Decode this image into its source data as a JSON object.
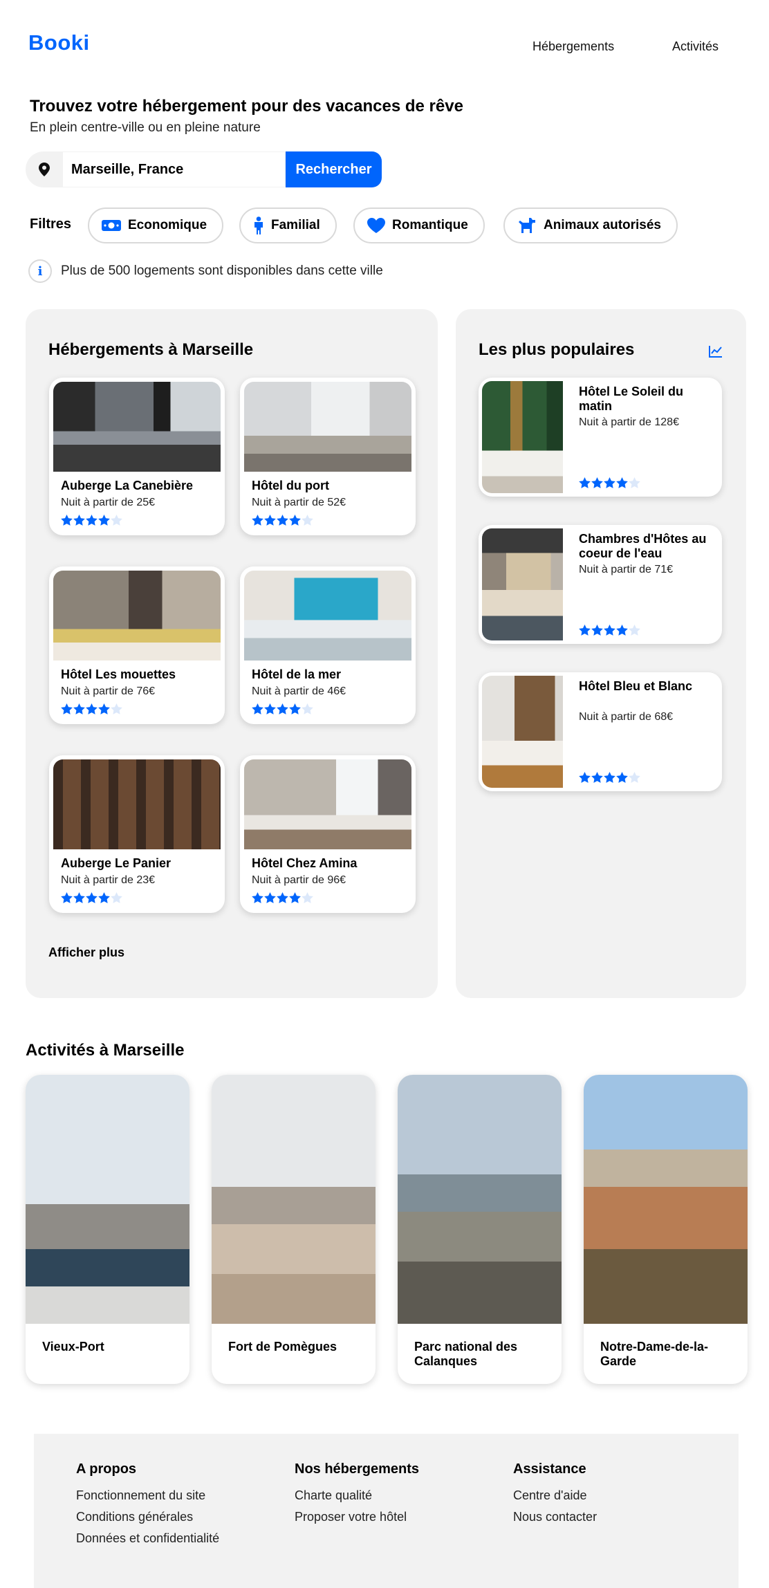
{
  "header": {
    "logo": "Booki",
    "nav": [
      "Hébergements",
      "Activités"
    ]
  },
  "hero": {
    "title": "Trouvez votre hébergement pour des vacances de rêve",
    "subtitle": "En plein centre-ville ou en pleine nature"
  },
  "search": {
    "value": "Marseille, France",
    "button_label": "Rechercher",
    "icon": "location-pin-icon"
  },
  "filters": {
    "label": "Filtres",
    "items": [
      {
        "label": "Economique",
        "icon": "money-icon"
      },
      {
        "label": "Familial",
        "icon": "person-icon"
      },
      {
        "label": "Romantique",
        "icon": "heart-icon"
      },
      {
        "label": "Animaux autorisés",
        "icon": "dog-icon"
      }
    ]
  },
  "info": {
    "icon": "info-icon",
    "text": "Plus de 500 logements sont disponibles dans cette ville"
  },
  "accommodations": {
    "title": "Hébergements à Marseille",
    "more_label": "Afficher plus",
    "items": [
      {
        "name": "Auberge La Canebière",
        "price": "Nuit à partir de 25€",
        "rating": 4
      },
      {
        "name": "Hôtel du port",
        "price": "Nuit à partir de 52€",
        "rating": 4
      },
      {
        "name": "Hôtel Les mouettes",
        "price": "Nuit à partir de 76€",
        "rating": 4
      },
      {
        "name": "Hôtel de la mer",
        "price": "Nuit à partir de 46€",
        "rating": 4
      },
      {
        "name": "Auberge Le Panier",
        "price": "Nuit à partir de 23€",
        "rating": 4
      },
      {
        "name": "Hôtel Chez Amina",
        "price": "Nuit à partir de 96€",
        "rating": 4
      }
    ]
  },
  "popular": {
    "title": "Les plus populaires",
    "icon": "trending-chart-icon",
    "items": [
      {
        "name": "Hôtel Le Soleil du matin",
        "price": "Nuit à partir de 128€",
        "rating": 4
      },
      {
        "name": "Chambres d'Hôtes au coeur de l'eau",
        "price": "Nuit à partir de 71€",
        "rating": 4
      },
      {
        "name": "Hôtel Bleu et Blanc",
        "price": "Nuit à partir de 68€",
        "rating": 4
      }
    ]
  },
  "activities": {
    "title": "Activités à Marseille",
    "items": [
      {
        "name": "Vieux-Port"
      },
      {
        "name": "Fort de Pomègues"
      },
      {
        "name": "Parc national des Calanques"
      },
      {
        "name": "Notre-Dame-de-la-Garde"
      }
    ]
  },
  "footer": {
    "columns": [
      {
        "title": "A propos",
        "links": [
          "Fonctionnement du site",
          "Conditions générales",
          "Données et confidentialité"
        ]
      },
      {
        "title": "Nos hébergements",
        "links": [
          "Charte qualité",
          "Proposer votre hôtel"
        ]
      },
      {
        "title": "Assistance",
        "links": [
          "Centre d'aide",
          "Nous contacter"
        ]
      }
    ]
  },
  "colors": {
    "accent": "#0065FC",
    "panel_bg": "#F2F2F2",
    "star_empty": "#DCE8FA"
  }
}
